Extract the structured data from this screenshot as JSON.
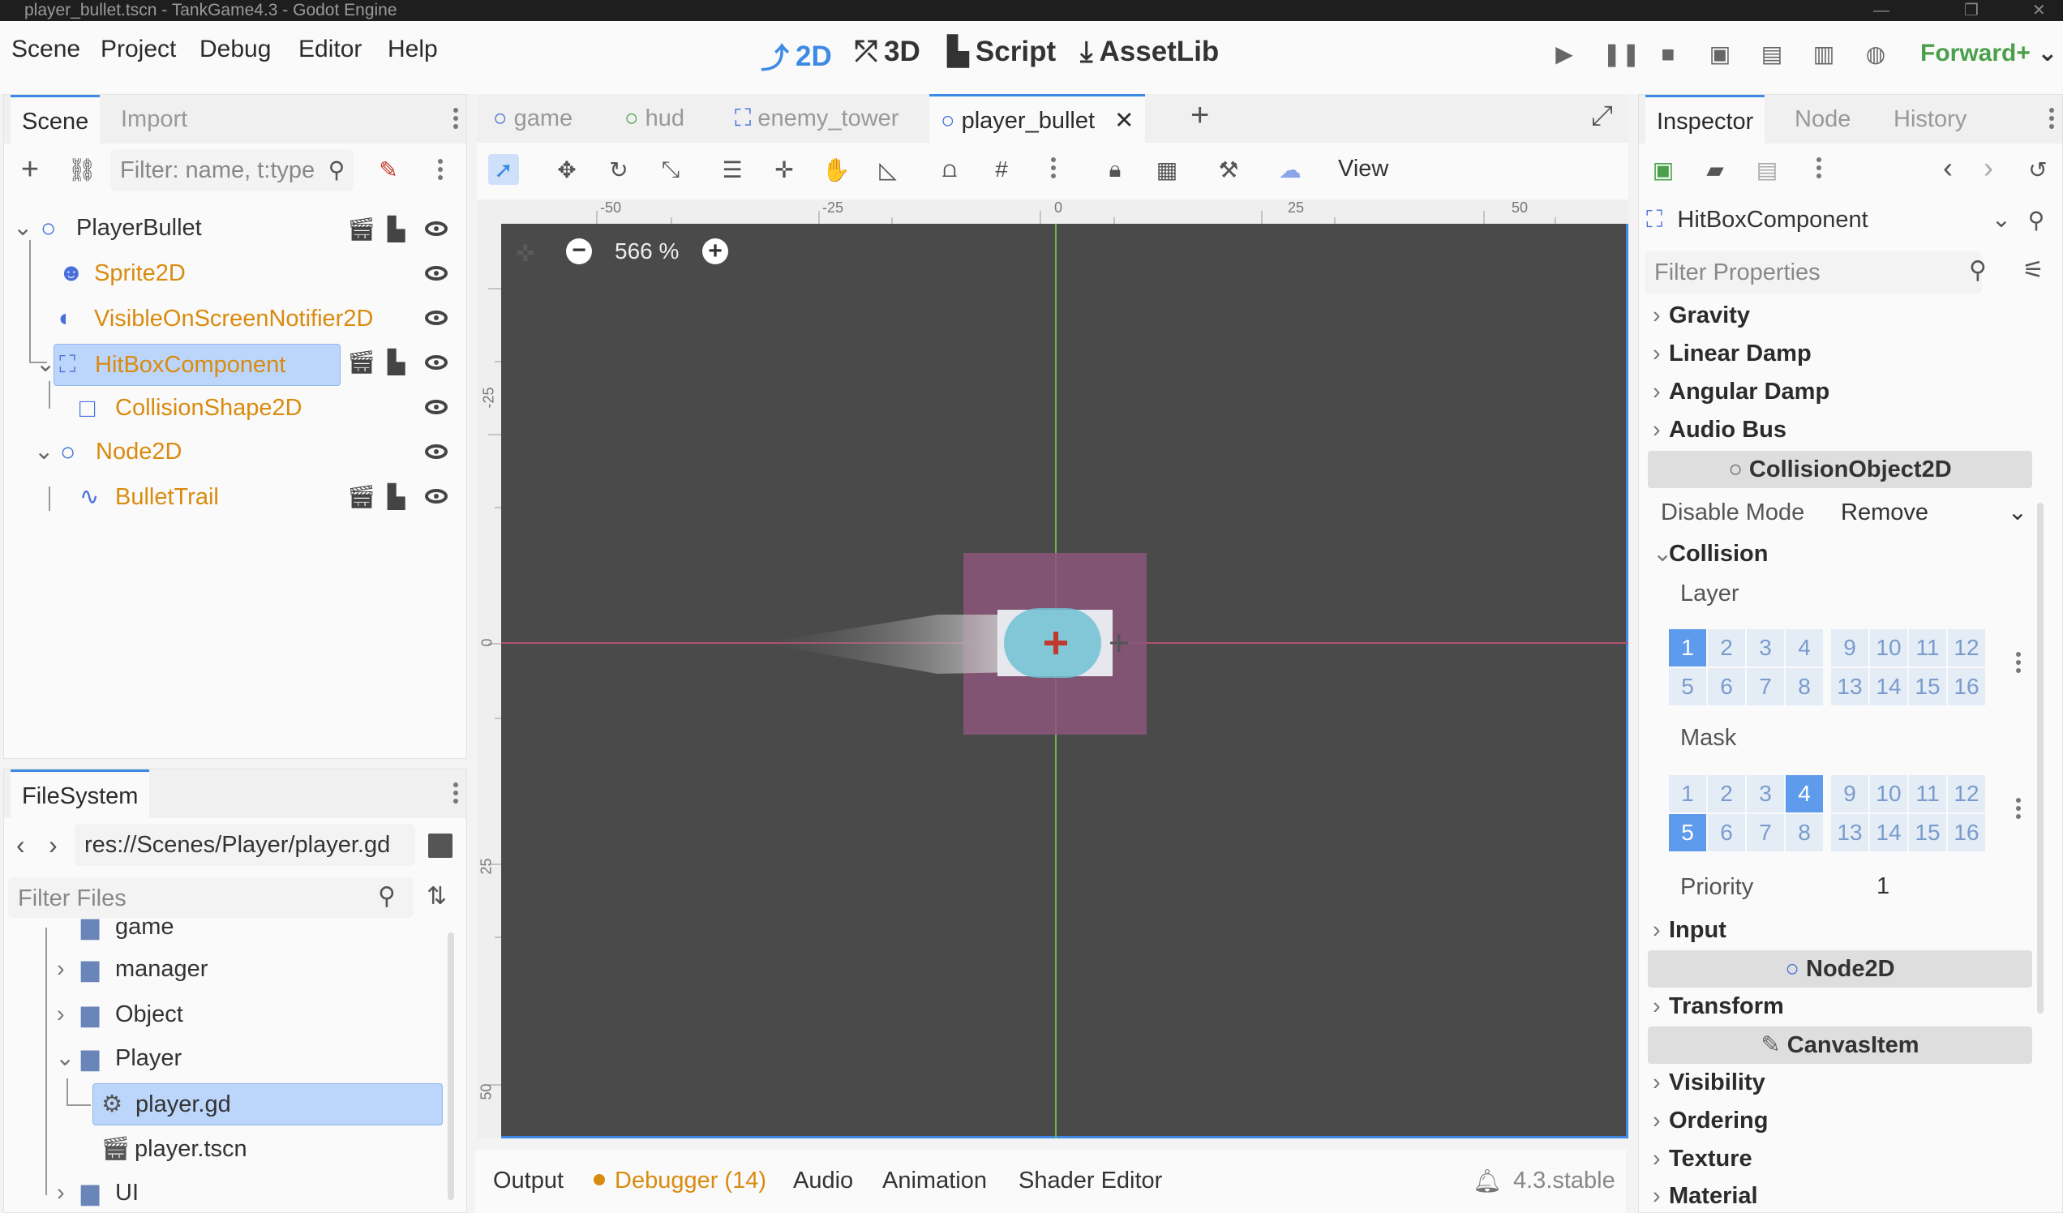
{
  "window": {
    "title": "player_bullet.tscn - TankGame4.3 - Godot Engine"
  },
  "menu": {
    "items": [
      "Scene",
      "Project",
      "Debug",
      "Editor",
      "Help"
    ]
  },
  "workspaces": {
    "two_d": "2D",
    "three_d": "3D",
    "script": "Script",
    "assetlib": "AssetLib"
  },
  "renderer": "Forward+",
  "scene_dock": {
    "tabs": [
      "Scene",
      "Import"
    ],
    "filter_placeholder": "Filter: name, t:type",
    "nodes": [
      {
        "name": "PlayerBullet",
        "icon": "node2d-circle-icon"
      },
      {
        "name": "Sprite2D",
        "icon": "sprite-icon"
      },
      {
        "name": "VisibleOnScreenNotifier2D",
        "icon": "notifier-icon"
      },
      {
        "name": "HitBoxComponent",
        "icon": "area2d-icon"
      },
      {
        "name": "CollisionShape2D",
        "icon": "collision-shape-icon"
      },
      {
        "name": "Node2D",
        "icon": "node2d-circle-icon"
      },
      {
        "name": "BulletTrail",
        "icon": "line2d-icon"
      }
    ]
  },
  "filesystem": {
    "tab": "FileSystem",
    "path": "res://Scenes/Player/player.gd",
    "filter_placeholder": "Filter Files",
    "items": [
      "game",
      "manager",
      "Object",
      "Player",
      "player.gd",
      "player.tscn",
      "UI"
    ]
  },
  "editor_tabs": [
    "game",
    "hud",
    "enemy_tower",
    "player_bullet"
  ],
  "viewport": {
    "zoom": "566 %",
    "view_label": "View",
    "ruler_h": [
      "-50",
      "-25",
      "0",
      "25",
      "50"
    ],
    "ruler_v": [
      "-25",
      "0",
      "25",
      "50"
    ]
  },
  "inspector": {
    "tabs": [
      "Inspector",
      "Node",
      "History"
    ],
    "selected_node": "HitBoxComponent",
    "filter_placeholder": "Filter Properties",
    "sections_top": [
      "Gravity",
      "Linear Damp",
      "Angular Damp",
      "Audio Bus"
    ],
    "cat_collision_object": "CollisionObject2D",
    "disable_mode_label": "Disable Mode",
    "disable_mode_value": "Remove",
    "collision_section": "Collision",
    "layer_label": "Layer",
    "mask_label": "Mask",
    "layer_row1": [
      "1",
      "2",
      "3",
      "4",
      "9",
      "10",
      "11",
      "12"
    ],
    "layer_row2": [
      "5",
      "6",
      "7",
      "8",
      "13",
      "14",
      "15",
      "16"
    ],
    "layer_enabled": [
      "1"
    ],
    "mask_enabled": [
      "4",
      "5"
    ],
    "priority_label": "Priority",
    "priority_value": "1",
    "input_section": "Input",
    "cat_node2d": "Node2D",
    "transform_section": "Transform",
    "cat_canvasitem": "CanvasItem",
    "sections_bottom": [
      "Visibility",
      "Ordering",
      "Texture",
      "Material"
    ]
  },
  "bottom_panel": {
    "tabs": [
      "Output",
      "Debugger (14)",
      "Audio",
      "Animation",
      "Shader Editor"
    ],
    "version": "4.3.stable"
  },
  "colors": {
    "accent": "#3d8ae6",
    "node_orange": "#d98b0f",
    "viewport_bg": "#4a4a4a"
  }
}
